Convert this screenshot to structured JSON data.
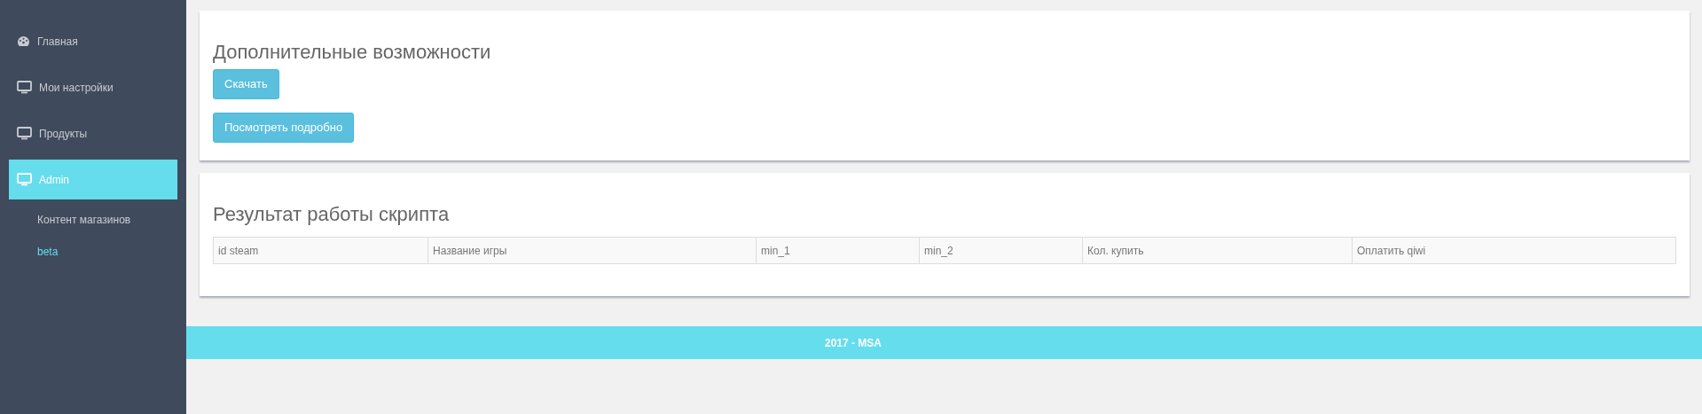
{
  "sidebar": {
    "items": [
      {
        "label": "Главная",
        "kind": "dashboard",
        "selected": false
      },
      {
        "label": "Мои настройки",
        "kind": "monitor",
        "selected": false
      },
      {
        "label": "Продукты",
        "kind": "monitor",
        "selected": false
      },
      {
        "label": "Admin",
        "kind": "monitor",
        "selected": true,
        "children": [
          {
            "label": "Контент магазинов",
            "selected": false
          },
          {
            "label": "beta",
            "selected": true
          }
        ]
      }
    ]
  },
  "panels": [
    {
      "title": "Дополнительные возможности",
      "buttons": [
        "Скачать",
        "Посмотреть подробно"
      ]
    },
    {
      "title": "Результат работы скрипта",
      "table": {
        "columns": [
          "id steam",
          "Название игры",
          "min_1",
          "min_2",
          "Кол. купить",
          "Оплатить qiwi"
        ]
      }
    }
  ],
  "footer": "2017 - MSA"
}
